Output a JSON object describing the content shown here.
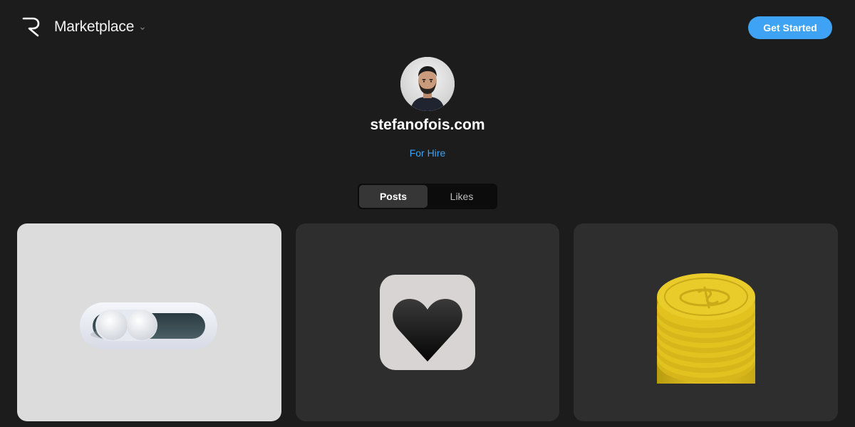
{
  "header": {
    "logo_icon": "r-logo-icon",
    "brand_label": "Marketplace",
    "brand_dropdown_icon": "chevron-down-icon",
    "cta_label": "Get Started"
  },
  "profile": {
    "avatar_icon": "user-avatar",
    "name": "stefanofois.com",
    "status_link": "For Hire"
  },
  "tabs": [
    {
      "label": "Posts",
      "active": true
    },
    {
      "label": "Likes",
      "active": false
    }
  ],
  "posts": [
    {
      "thumbnail_icon": "toggle-switch-icon"
    },
    {
      "thumbnail_icon": "heart-icon"
    },
    {
      "thumbnail_icon": "coin-stack-icon"
    }
  ],
  "colors": {
    "background": "#1c1c1c",
    "accent": "#3ea3f5",
    "card_dark": "#2e2e2e",
    "card_light": "#dcdcdc",
    "coin_gold": "#e8c31a"
  }
}
